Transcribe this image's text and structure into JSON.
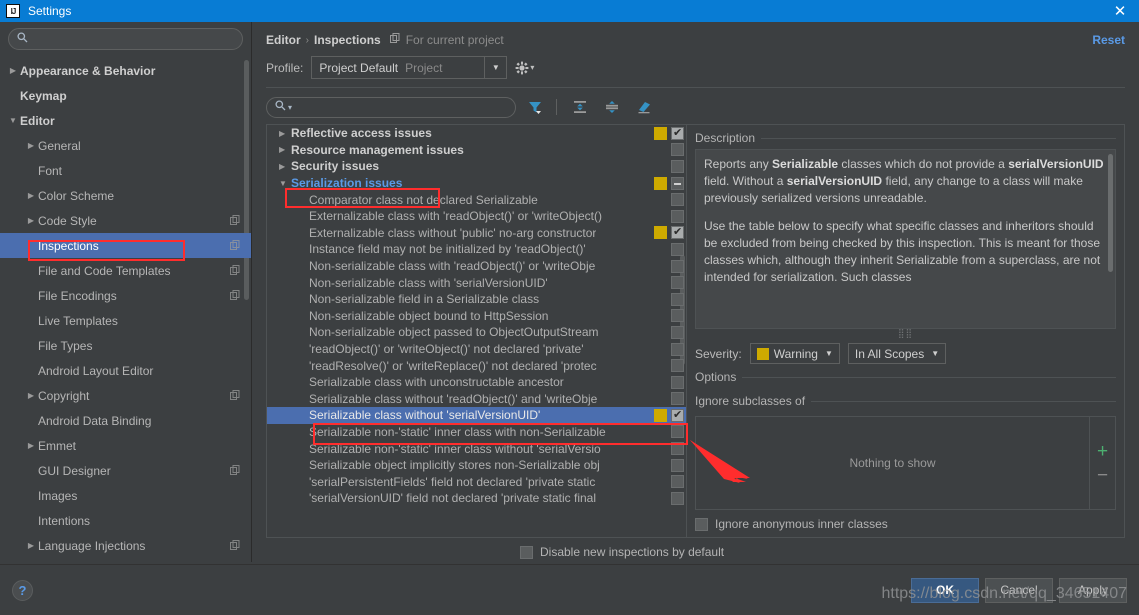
{
  "window": {
    "title": "Settings",
    "logo_text": "IJ",
    "close_label": "✕"
  },
  "sidebar": {
    "search_placeholder": "",
    "search_value": "",
    "items": [
      {
        "label": "Appearance & Behavior",
        "level": 0,
        "twisty": "collapsed",
        "copy": false
      },
      {
        "label": "Keymap",
        "level": 0,
        "twisty": "none",
        "copy": false
      },
      {
        "label": "Editor",
        "level": 0,
        "twisty": "expanded",
        "copy": false
      },
      {
        "label": "General",
        "level": 1,
        "twisty": "collapsed",
        "copy": false
      },
      {
        "label": "Font",
        "level": 1,
        "twisty": "none",
        "copy": false
      },
      {
        "label": "Color Scheme",
        "level": 1,
        "twisty": "collapsed",
        "copy": false
      },
      {
        "label": "Code Style",
        "level": 1,
        "twisty": "collapsed",
        "copy": true
      },
      {
        "label": "Inspections",
        "level": 1,
        "twisty": "none",
        "copy": true,
        "selected": true,
        "highlighted": true
      },
      {
        "label": "File and Code Templates",
        "level": 1,
        "twisty": "none",
        "copy": true
      },
      {
        "label": "File Encodings",
        "level": 1,
        "twisty": "none",
        "copy": true
      },
      {
        "label": "Live Templates",
        "level": 1,
        "twisty": "none",
        "copy": false
      },
      {
        "label": "File Types",
        "level": 1,
        "twisty": "none",
        "copy": false
      },
      {
        "label": "Android Layout Editor",
        "level": 1,
        "twisty": "none",
        "copy": false
      },
      {
        "label": "Copyright",
        "level": 1,
        "twisty": "collapsed",
        "copy": true
      },
      {
        "label": "Android Data Binding",
        "level": 1,
        "twisty": "none",
        "copy": false
      },
      {
        "label": "Emmet",
        "level": 1,
        "twisty": "collapsed",
        "copy": false
      },
      {
        "label": "GUI Designer",
        "level": 1,
        "twisty": "none",
        "copy": true
      },
      {
        "label": "Images",
        "level": 1,
        "twisty": "none",
        "copy": false
      },
      {
        "label": "Intentions",
        "level": 1,
        "twisty": "none",
        "copy": false
      },
      {
        "label": "Language Injections",
        "level": 1,
        "twisty": "collapsed",
        "copy": true
      }
    ]
  },
  "header": {
    "breadcrumb_parent": "Editor",
    "breadcrumb_sep": "›",
    "breadcrumb_current": "Inspections",
    "breadcrumb_note": "For current project",
    "reset_label": "Reset"
  },
  "profile": {
    "label": "Profile:",
    "value": "Project Default",
    "scope": "Project",
    "caret": "▼",
    "gear_caret": "▾"
  },
  "filter_toolbar": {
    "search_value": "",
    "search_caret": "▾",
    "buttons": [
      {
        "name": "filter-icon",
        "title": "Filter inspections"
      },
      {
        "name": "expand-all-icon",
        "title": "Expand all"
      },
      {
        "name": "collapse-all-icon",
        "title": "Collapse all"
      },
      {
        "name": "reset-inspections-icon",
        "title": "Reset to defaults"
      }
    ]
  },
  "inspections": [
    {
      "label": "Reflective access issues",
      "type": "group",
      "twisty": "▶",
      "severity": true,
      "check": "checked"
    },
    {
      "label": "Resource management issues",
      "type": "group",
      "twisty": "▶",
      "severity": false,
      "check": "unchecked"
    },
    {
      "label": "Security issues",
      "type": "group",
      "twisty": "▶",
      "severity": false,
      "check": "unchecked"
    },
    {
      "label": "Serialization issues",
      "type": "group",
      "twisty": "▼",
      "severity": true,
      "check": "partial",
      "expanded": true,
      "highlighted": true
    },
    {
      "label": "Comparator class not declared Serializable",
      "type": "leaf",
      "severity": false,
      "check": "unchecked"
    },
    {
      "label": "Externalizable class with 'readObject()' or 'writeObject()",
      "type": "leaf",
      "severity": false,
      "check": "unchecked"
    },
    {
      "label": "Externalizable class without 'public' no-arg constructor",
      "type": "leaf",
      "severity": true,
      "check": "checked"
    },
    {
      "label": "Instance field may not be initialized by 'readObject()'",
      "type": "leaf",
      "severity": false,
      "check": "unchecked"
    },
    {
      "label": "Non-serializable class with 'readObject()' or 'writeObje",
      "type": "leaf",
      "severity": false,
      "check": "unchecked"
    },
    {
      "label": "Non-serializable class with 'serialVersionUID'",
      "type": "leaf",
      "severity": false,
      "check": "unchecked"
    },
    {
      "label": "Non-serializable field in a Serializable class",
      "type": "leaf",
      "severity": false,
      "check": "unchecked"
    },
    {
      "label": "Non-serializable object bound to HttpSession",
      "type": "leaf",
      "severity": false,
      "check": "unchecked"
    },
    {
      "label": "Non-serializable object passed to ObjectOutputStream",
      "type": "leaf",
      "severity": false,
      "check": "unchecked"
    },
    {
      "label": "'readObject()' or 'writeObject()' not declared 'private'",
      "type": "leaf",
      "severity": false,
      "check": "unchecked"
    },
    {
      "label": "'readResolve()' or 'writeReplace()' not declared 'protec",
      "type": "leaf",
      "severity": false,
      "check": "unchecked"
    },
    {
      "label": "Serializable class with unconstructable ancestor",
      "type": "leaf",
      "severity": false,
      "check": "unchecked"
    },
    {
      "label": "Serializable class without 'readObject()' and 'writeObje",
      "type": "leaf",
      "severity": false,
      "check": "unchecked"
    },
    {
      "label": "Serializable class without 'serialVersionUID'",
      "type": "leaf",
      "severity": true,
      "check": "checked",
      "selected": true,
      "highlighted": true
    },
    {
      "label": "Serializable non-'static' inner class with non-Serializable",
      "type": "leaf",
      "severity": false,
      "check": "unchecked"
    },
    {
      "label": "Serializable non-'static' inner class without 'serialVersio",
      "type": "leaf",
      "severity": false,
      "check": "unchecked"
    },
    {
      "label": "Serializable object implicitly stores non-Serializable obj",
      "type": "leaf",
      "severity": false,
      "check": "unchecked"
    },
    {
      "label": "'serialPersistentFields' field not declared 'private static",
      "type": "leaf",
      "severity": false,
      "check": "unchecked"
    },
    {
      "label": "'serialVersionUID' field not declared 'private static final",
      "type": "leaf",
      "severity": false,
      "check": "unchecked"
    }
  ],
  "description": {
    "section_label": "Description",
    "para1_a": "Reports any ",
    "para1_b1": "Serializable",
    "para1_c": " classes which do not provide a ",
    "para1_b2": "serialVersionUID",
    "para1_d": " field. Without a ",
    "para1_b3": "serialVersionUID",
    "para1_e": " field, any change to a class will make previously serialized versions unreadable.",
    "para2": "Use the table below to specify what specific classes and inheritors should be excluded from being checked by this inspection. This is meant for those classes which, although they inherit Serializable from a superclass, are not intended for serialization. Such classes"
  },
  "severity": {
    "label": "Severity:",
    "value": "Warning",
    "color": "#ceaa00",
    "caret": "▼",
    "scope_value": "In All Scopes",
    "scope_caret": "▼"
  },
  "options": {
    "section_label": "Options",
    "ignore_subclasses_label": "Ignore subclasses of",
    "empty_text": "Nothing to show",
    "add_label": "+",
    "remove_label": "−",
    "checkbox_label": "Ignore anonymous inner classes",
    "checkbox_checked": false
  },
  "bottom": {
    "disable_label": "Disable new inspections by default",
    "disable_checked": false,
    "help_label": "?"
  },
  "footer": {
    "ok": "OK",
    "cancel": "Cancel",
    "apply": "Apply"
  },
  "watermark": "https://blog.csdn.net/qq_34651407"
}
